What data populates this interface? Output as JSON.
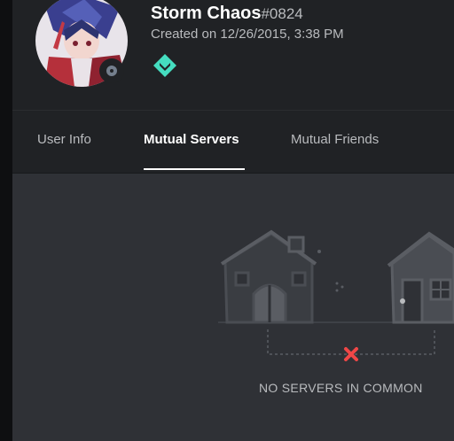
{
  "profile": {
    "username": "Storm Chaos",
    "discriminator": "#0824",
    "created": "Created on 12/26/2015, 3:38 PM",
    "status": "offline",
    "badge_icon": "hypesquad-balance-icon",
    "badge_color": "#45ddc0"
  },
  "tabs": [
    {
      "label": "User Info",
      "active": false
    },
    {
      "label": "Mutual Servers",
      "active": true
    },
    {
      "label": "Mutual Friends",
      "active": false
    }
  ],
  "empty_state": {
    "message": "NO SERVERS IN COMMON",
    "icon": "houses-illustration"
  },
  "colors": {
    "header_bg": "#202225",
    "content_bg": "#2f3136",
    "error_x": "#f04747"
  }
}
